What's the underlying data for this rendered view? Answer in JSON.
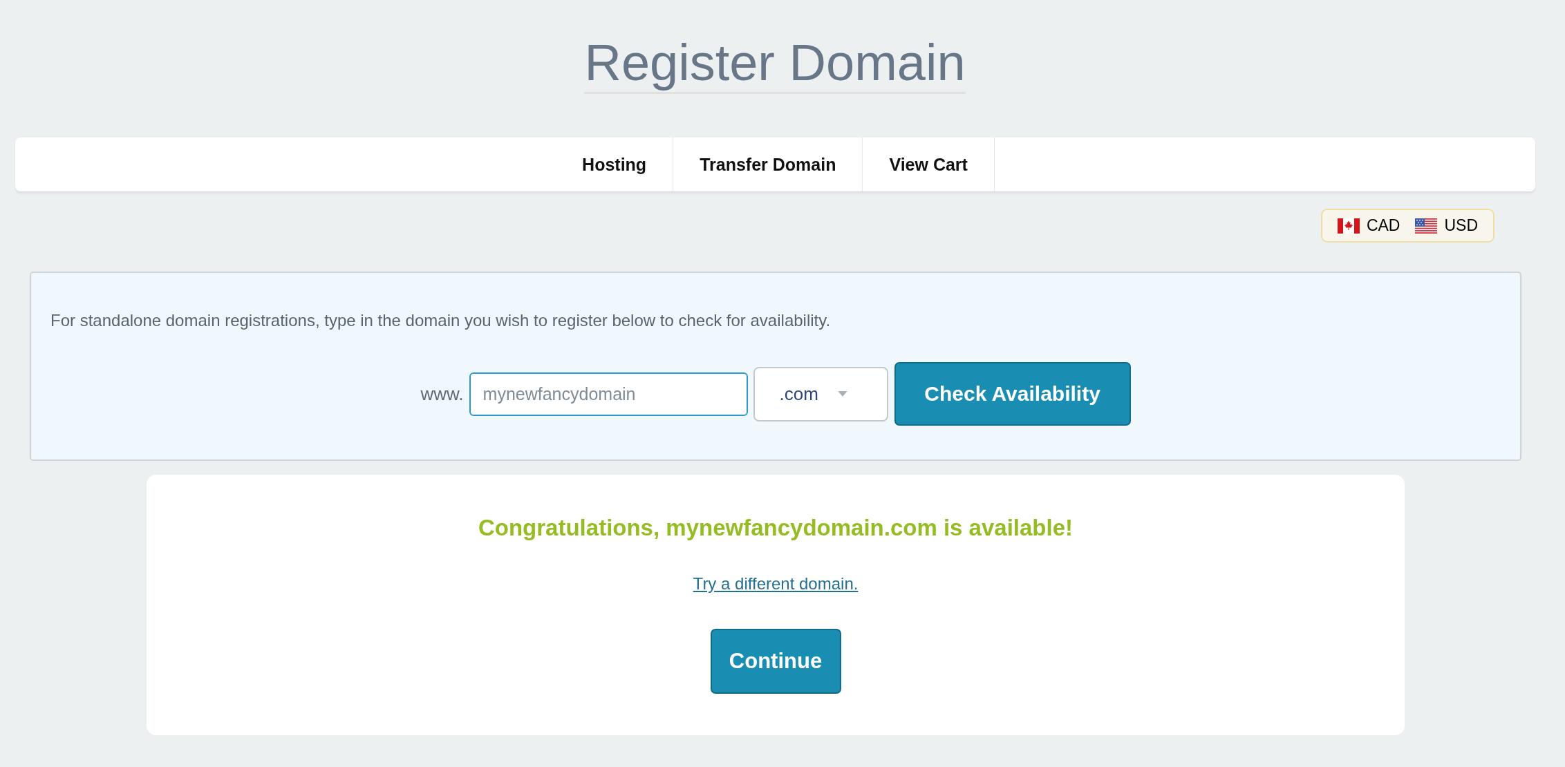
{
  "page": {
    "title": "Register Domain"
  },
  "nav": {
    "items": [
      {
        "label": "Hosting"
      },
      {
        "label": "Transfer Domain"
      },
      {
        "label": "View Cart"
      }
    ]
  },
  "currency": [
    {
      "kind": "canada",
      "code": "CAD"
    },
    {
      "kind": "usa",
      "code": "USD"
    }
  ],
  "search": {
    "intro": "For standalone domain registrations, type in the domain you wish to register below to check for availability.",
    "prefix": "www.",
    "domain_field": {
      "value": "mynewfancydomain"
    },
    "tld_select": {
      "value": ".com"
    },
    "button": "Check Availability"
  },
  "result": {
    "message": "Congratulations, mynewfancydomain.com is available!",
    "link": "Try a different domain.",
    "button": "Continue"
  }
}
